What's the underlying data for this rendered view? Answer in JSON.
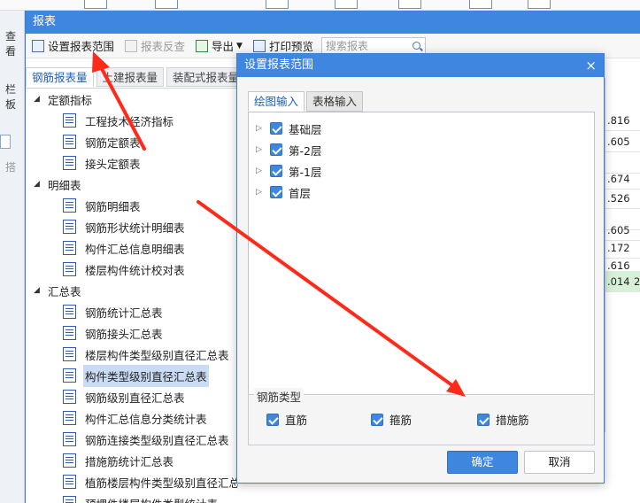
{
  "window": {
    "title": "报表"
  },
  "background": {
    "left_labels": [
      "查看",
      "栏板",
      "搭"
    ],
    "grid_values": [
      ".816",
      ".605",
      "",
      ".674",
      ".526",
      "",
      ".605",
      ".172",
      ".616",
      ".014"
    ],
    "grid_extra": "2"
  },
  "toolbar": {
    "set_range": "设置报表范围",
    "report_check": "报表反查",
    "export": "导出",
    "print_preview": "打印预览",
    "search_placeholder": "搜索报表"
  },
  "tabs": [
    "钢筋报表量",
    "土建报表量",
    "装配式报表量"
  ],
  "tree": {
    "groups": [
      {
        "label": "定额指标",
        "items": [
          "工程技术经济指标",
          "钢筋定额表",
          "接头定额表"
        ]
      },
      {
        "label": "明细表",
        "items": [
          "钢筋明细表",
          "钢筋形状统计明细表",
          "构件汇总信息明细表",
          "楼层构件统计校对表"
        ]
      },
      {
        "label": "汇总表",
        "items": [
          "钢筋统计汇总表",
          "钢筋接头汇总表",
          "楼层构件类型级别直径汇总表",
          "构件类型级别直径汇总表",
          "钢筋级别直径汇总表",
          "构件汇总信息分类统计表",
          "钢筋连接类型级别直径汇总表",
          "措施筋统计汇总表",
          "植筋楼层构件类型级别直径汇总表",
          "预埋件楼层构件类型统计表"
        ]
      }
    ],
    "selected": "构件类型级别直径汇总表"
  },
  "dialog": {
    "title": "设置报表范围",
    "close": "×",
    "tabs": [
      "绘图输入",
      "表格输入"
    ],
    "floors": [
      "基础层",
      "第-2层",
      "第-1层",
      "首层"
    ],
    "steel_group_title": "钢筋类型",
    "steel_types": [
      "直筋",
      "箍筋",
      "措施筋"
    ],
    "ok": "确定",
    "cancel": "取消"
  },
  "colors": {
    "accent": "#3e86e0",
    "annotation": "#ff2a1a",
    "selected_row": "#c9dcf4"
  }
}
